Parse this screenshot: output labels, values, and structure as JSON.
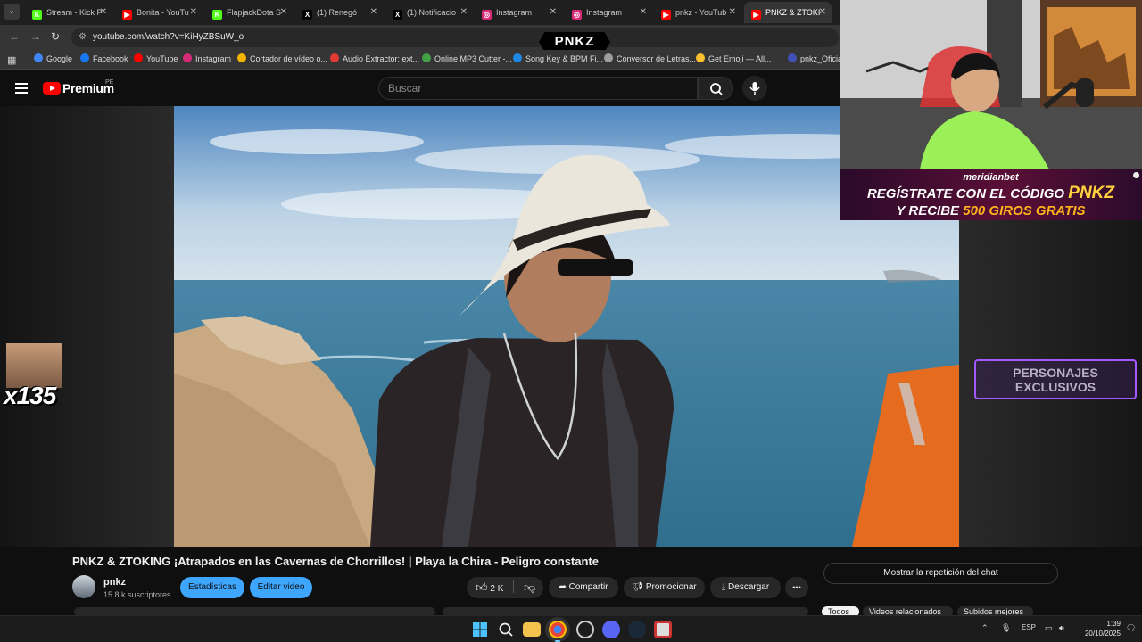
{
  "browser": {
    "tabs": [
      {
        "label": "Stream - Kick P",
        "favicon_color": "#53fc18",
        "favicon_glyph": "K"
      },
      {
        "label": "Bonita - YouTu",
        "favicon_color": "#ff0000",
        "favicon_glyph": "▶"
      },
      {
        "label": "FlapjackDota S",
        "favicon_color": "#53fc18",
        "favicon_glyph": "K"
      },
      {
        "label": "(1) Renegó",
        "favicon_color": "#000000",
        "favicon_glyph": "X"
      },
      {
        "label": "(1) Notificacio",
        "favicon_color": "#000000",
        "favicon_glyph": "X"
      },
      {
        "label": "Instagram",
        "favicon_color": "#d62976",
        "favicon_glyph": "◎"
      },
      {
        "label": "Instagram",
        "favicon_color": "#d62976",
        "favicon_glyph": "◎"
      },
      {
        "label": "pnkz - YouTub",
        "favicon_color": "#ff0000",
        "favicon_glyph": "▶"
      },
      {
        "label": "PNKZ & ZTOKI",
        "favicon_color": "#ff0000",
        "favicon_glyph": "▶"
      }
    ],
    "active_tab_index": 8,
    "url": "youtube.com/watch?v=KiHyZBSuW_o",
    "stream_logo": "PNKZ",
    "bookmarks": [
      {
        "label": "Google",
        "color": "#4285f4"
      },
      {
        "label": "Facebook",
        "color": "#1877f2"
      },
      {
        "label": "YouTube",
        "color": "#ff0000"
      },
      {
        "label": "Instagram",
        "color": "#d62976"
      },
      {
        "label": "Cortador de vídeo o...",
        "color": "#f4b400"
      },
      {
        "label": "Audio Extractor: ext...",
        "color": "#e53935"
      },
      {
        "label": "Online MP3 Cutter -...",
        "color": "#43a047"
      },
      {
        "label": "Song Key & BPM Fi...",
        "color": "#1e88e5"
      },
      {
        "label": "Conversor de Letras...",
        "color": "#9e9e9e"
      },
      {
        "label": "Get Emoji — All...",
        "color": "#fbc02d"
      },
      {
        "label": "pnkz_Oficial",
        "color": "#3f51b5"
      }
    ]
  },
  "youtube": {
    "logo_text": "Premium",
    "region": "PE",
    "search_placeholder": "Buscar",
    "video_title": "PNKZ & ZTOKING ¡Atrapados en las Cavernas de Chorrillos! | Playa la Chira - Peligro constante",
    "channel_name": "pnkz",
    "subscribers": "15.8 k suscriptores",
    "buttons": {
      "stats": "Estadísticas",
      "edit": "Editar video",
      "likes": "2 K",
      "share": "Compartir",
      "promote": "Promocionar",
      "download": "Descargar",
      "more": "•••",
      "chat_replay": "Mostrar la repetición del chat"
    },
    "chips": [
      "Todos",
      "Videos relacionados",
      "Subidos mejores"
    ]
  },
  "overlay": {
    "emote_count": "x135",
    "exclusive_line1": "PERSONAJES",
    "exclusive_line2": "EXCLUSIVOS",
    "banner_brand": "meridianbet",
    "banner_line1": "REGÍSTRATE CON EL CÓDIGO",
    "banner_code": "PNKZ",
    "banner_line2_pre": "Y RECIBE",
    "banner_line2_hl": "500 GIROS GRATIS"
  },
  "taskbar": {
    "language": "ESP",
    "time": "1:39",
    "date": "20/10/2025"
  }
}
